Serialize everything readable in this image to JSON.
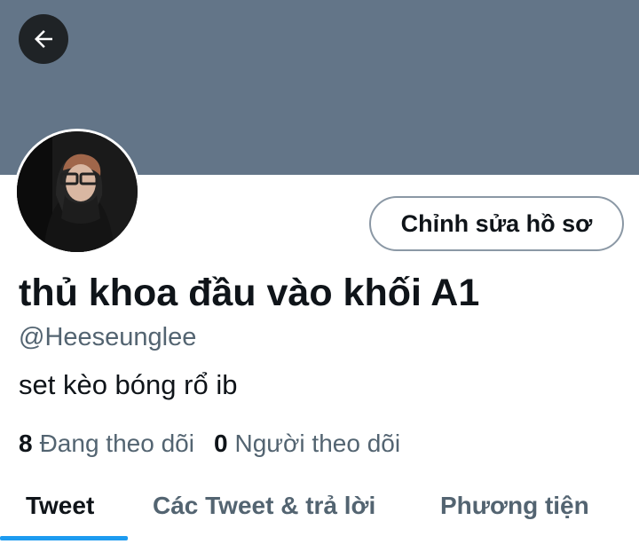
{
  "header": {
    "back_icon": "arrow-left-icon",
    "banner_color": "#637588"
  },
  "profile": {
    "avatar": "profile-photo",
    "edit_button_label": "Chỉnh sửa hồ sơ",
    "display_name": "thủ khoa đầu vào khối A1",
    "handle": "@Heeseunglee",
    "bio": "set kèo bóng rổ ib",
    "following_count": "8",
    "following_label": "Đang theo dõi",
    "followers_count": "0",
    "followers_label": "Người theo dõi"
  },
  "tabs": [
    {
      "label": "Tweet",
      "active": true
    },
    {
      "label": "Các Tweet & trả lời",
      "active": false
    },
    {
      "label": "Phương tiện",
      "active": false
    }
  ],
  "colors": {
    "accent": "#1d9bf0",
    "muted_text": "#536471"
  }
}
